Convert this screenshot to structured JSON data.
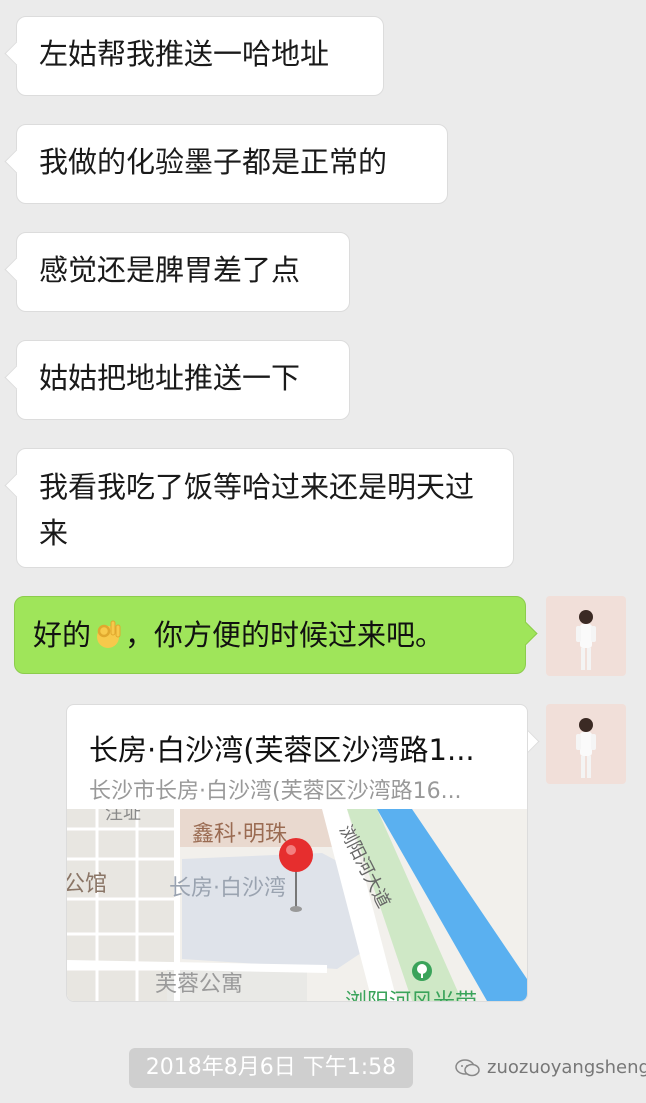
{
  "messages_in": [
    {
      "text": "左姑帮我推送一哈地址"
    },
    {
      "text": "我做的化验墨子都是正常的"
    },
    {
      "text": "感觉还是脾胃差了点"
    },
    {
      "text": "姑姑把地址推送一下"
    },
    {
      "text": "我看我吃了饭等哈过来还是明天过来"
    }
  ],
  "message_out": {
    "before": "好的",
    "emoji_name": "ok-hand-emoji",
    "after": "，你方便的时候过来吧。"
  },
  "location": {
    "title": "长房·白沙湾(芙蓉区沙湾路1...",
    "subtitle": "长沙市长房·白沙湾(芙蓉区沙湾路16...",
    "map_labels": {
      "north_complex": "鑫科·明珠",
      "left_partial": "公馆",
      "top_partial": "注址",
      "center": "长房·白沙湾",
      "road": "浏阳河大道",
      "south": "芙蓉公寓",
      "park": "浏阳河风光带"
    },
    "colors": {
      "river": "#5ab0f0",
      "block": "#dfe3ea",
      "pin": "#e62e2e"
    }
  },
  "timestamp": "2018年8月6日 下午1:58",
  "watermark": "zuozuoyangsheng",
  "colors": {
    "background": "#ebebeb",
    "outgoing_bubble": "#9fe55a",
    "incoming_bubble": "#ffffff"
  }
}
